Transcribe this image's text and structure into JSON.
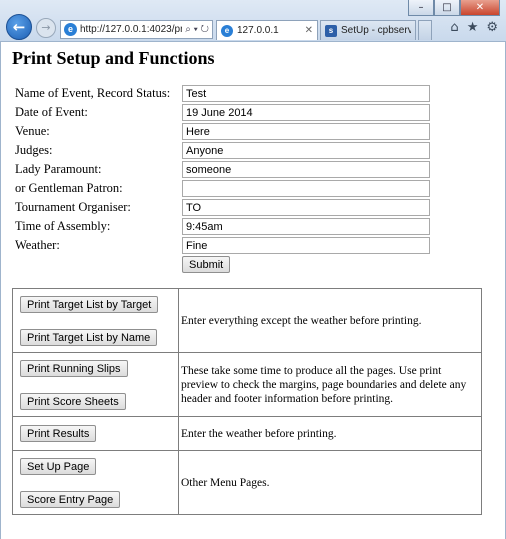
{
  "browser": {
    "address_url": "http://127.0.0.1:4023/pr",
    "address_controls": "⌕ ▾ ↻",
    "tabs": [
      {
        "label": "127.0.0.1",
        "close": "✕"
      },
      {
        "label": "SetUp - cpbserver ..."
      }
    ],
    "window_buttons": {
      "minimize": "–",
      "maximize": "□",
      "close": "✕"
    }
  },
  "page": {
    "title": "Print Setup and Functions"
  },
  "form": {
    "fields": [
      {
        "label": "Name of Event, Record Status:",
        "value": "Test"
      },
      {
        "label": "Date of Event:",
        "value": "19 June 2014"
      },
      {
        "label": "Venue:",
        "value": "Here"
      },
      {
        "label": "Judges:",
        "value": "Anyone"
      },
      {
        "label": "Lady Paramount:",
        "value": "someone"
      },
      {
        "label": "or Gentleman Patron:",
        "value": ""
      },
      {
        "label": "Tournament Organiser:",
        "value": "TO"
      },
      {
        "label": "Time of Assembly:",
        "value": "9:45am"
      },
      {
        "label": "Weather:",
        "value": "Fine"
      }
    ],
    "submit_label": "Submit"
  },
  "menu": {
    "rows": [
      {
        "buttons": [
          "Print Target List by Target",
          "Print Target List by Name"
        ],
        "description": "Enter everything except the weather before printing."
      },
      {
        "buttons": [
          "Print Running Slips",
          "Print Score Sheets"
        ],
        "description": "These take some time to produce all the pages. Use print preview to check the margins, page boundaries and delete any header and footer information before printing."
      },
      {
        "buttons": [
          "Print Results"
        ],
        "description": "Enter the weather before printing."
      },
      {
        "buttons": [
          "Set Up Page",
          "Score Entry Page"
        ],
        "description": "Other Menu Pages."
      }
    ]
  }
}
